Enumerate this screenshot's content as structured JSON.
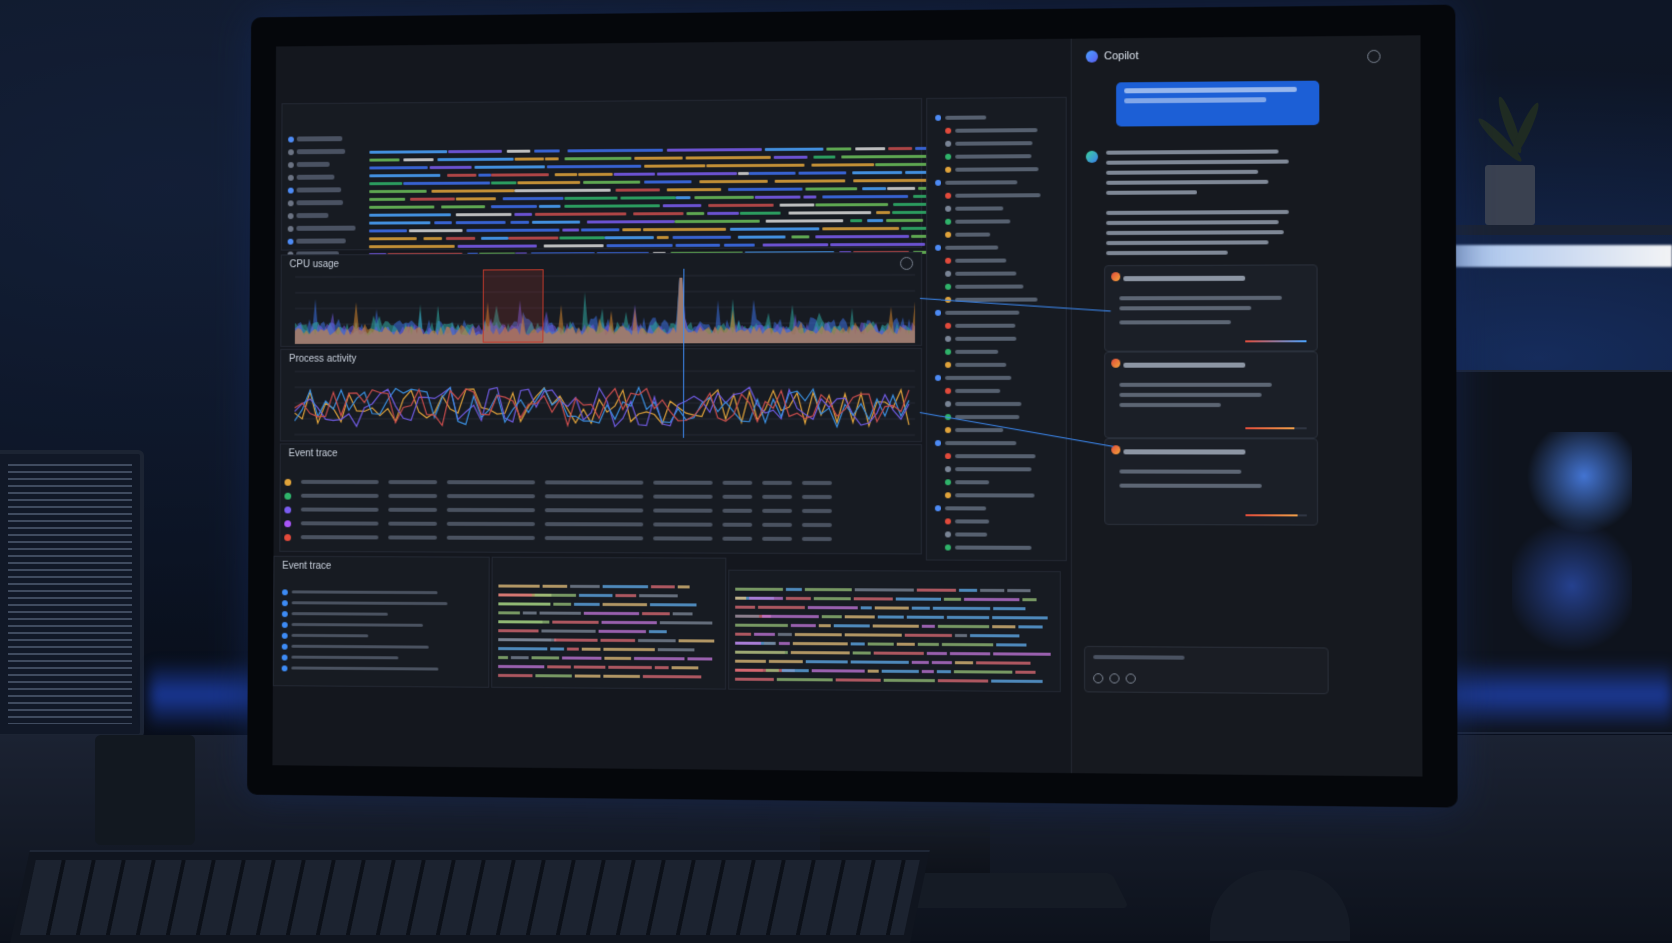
{
  "window": {
    "title": "",
    "controls": [
      "–",
      "□",
      "✕"
    ]
  },
  "cpu_panel": {
    "title": "CPU usage"
  },
  "process_panel": {
    "title": "Process activity"
  },
  "event_table": {
    "title": "Event trace"
  },
  "event_tree": {
    "title": "Event trace"
  },
  "copilot": {
    "title": "Copilot"
  },
  "colors": {
    "accent": "#1c5fd6",
    "link": "#3d8bf5",
    "highlight": "#c0392b"
  },
  "icons": [
    "copilot-icon",
    "minimize-icon",
    "maximize-icon",
    "close-icon",
    "settings-icon"
  ]
}
